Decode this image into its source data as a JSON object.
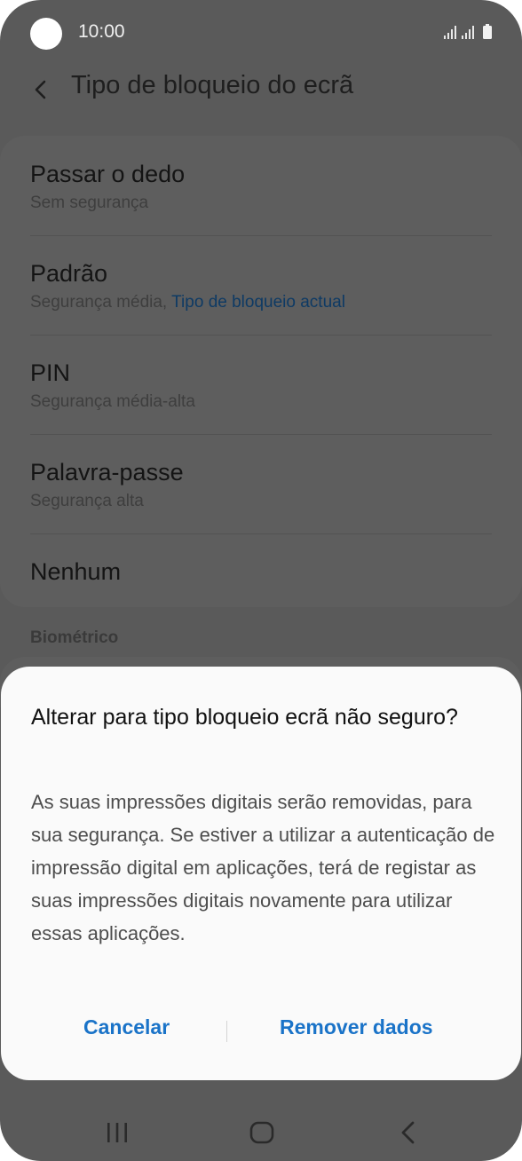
{
  "status_bar": {
    "time": "10:00"
  },
  "header": {
    "title": "Tipo de bloqueio do ecrã"
  },
  "lock_types": [
    {
      "title": "Passar o dedo",
      "subtitle": "Sem segurança"
    },
    {
      "title": "Padrão",
      "subtitle": "Segurança média,",
      "subtitle_highlight": "Tipo de bloqueio actual"
    },
    {
      "title": "PIN",
      "subtitle": "Segurança média-alta"
    },
    {
      "title": "Palavra-passe",
      "subtitle": "Segurança alta"
    },
    {
      "title": "Nenhum"
    }
  ],
  "section_biometric": "Biométrico",
  "dialog": {
    "title": "Alterar para tipo bloqueio ecrã não seguro?",
    "body": "As suas impressões digitais serão removidas, para sua segurança. Se estiver a utilizar a autenticação de impressão digital em aplicações, terá de registar as suas impressões digitais novamente para utilizar essas aplicações.",
    "cancel_label": "Cancelar",
    "confirm_label": "Remover dados"
  },
  "colors": {
    "accent": "#1a73c8",
    "dim_overlay": "#5a5a5a",
    "dialog_bg": "#fafafa"
  },
  "icons": [
    "back-arrow-icon",
    "signal-icon",
    "battery-icon",
    "recent-apps-icon",
    "home-icon",
    "nav-back-icon"
  ]
}
